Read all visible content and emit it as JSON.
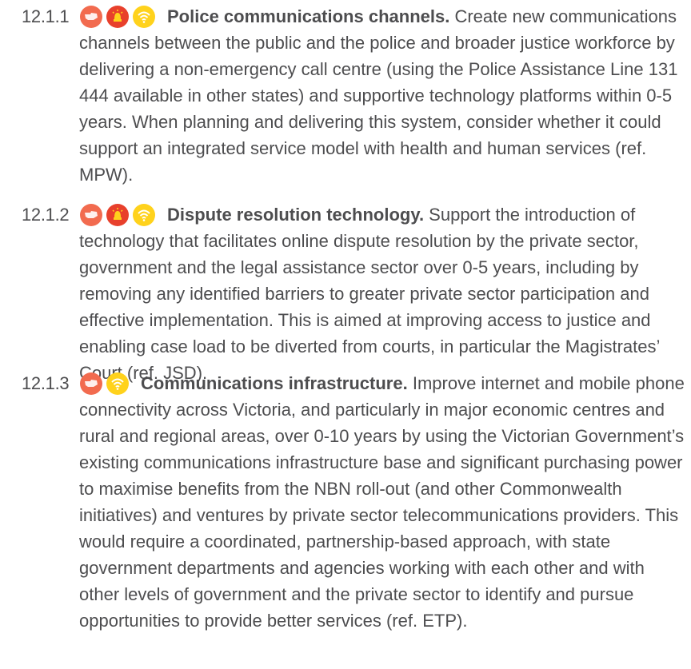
{
  "colors": {
    "text": "#4d4d4f",
    "orange": "#f26b4f",
    "red": "#e8402c",
    "yellow": "#ffd21c"
  },
  "recommendations": [
    {
      "number": "12.1.1",
      "icons": [
        "orange-bodypart-icon",
        "red-siren-icon",
        "yellow-wifi-icon"
      ],
      "title": "Police communications channels.",
      "text": " Create new communications channels between the public and the police and broader justice workforce by delivering a non-emergency call centre (using the Police Assistance Line 131 444 available in other states) and supportive technology platforms within 0-5 years. When planning and delivering this system, consider whether it could support an integrated service model with health and human services (ref. MPW)."
    },
    {
      "number": "12.1.2",
      "icons": [
        "orange-bodypart-icon",
        "red-siren-icon",
        "yellow-wifi-icon"
      ],
      "title": "Dispute resolution technology.",
      "text": " Support the introduction of technology that facilitates online dispute resolution by the private sector, government and the legal assistance sector over 0-5 years, including by removing any identified barriers to greater private sector participation and effective implementation. This is aimed at improving access to justice and enabling case load to be diverted from courts, in particular the Magistrates’ Court (ref. JSD)."
    },
    {
      "number": "12.1.3",
      "icons": [
        "orange-bodypart-icon",
        "yellow-wifi-icon"
      ],
      "title": "Communications infrastructure.",
      "text": " Improve internet and mobile phone connectivity across Victoria, and particularly in major economic centres and rural and regional areas, over 0-10 years by using the Victorian Government’s existing communications infrastructure base and significant purchasing power to maximise benefits from the NBN roll-out (and other Commonwealth initiatives) and ventures by private sector telecommunications providers. This would require a coordinated, partnership-based approach, with state government departments and agencies working with each other and with other levels of government and the private sector to identify and pursue opportunities to provide better services (ref. ETP)."
    }
  ]
}
